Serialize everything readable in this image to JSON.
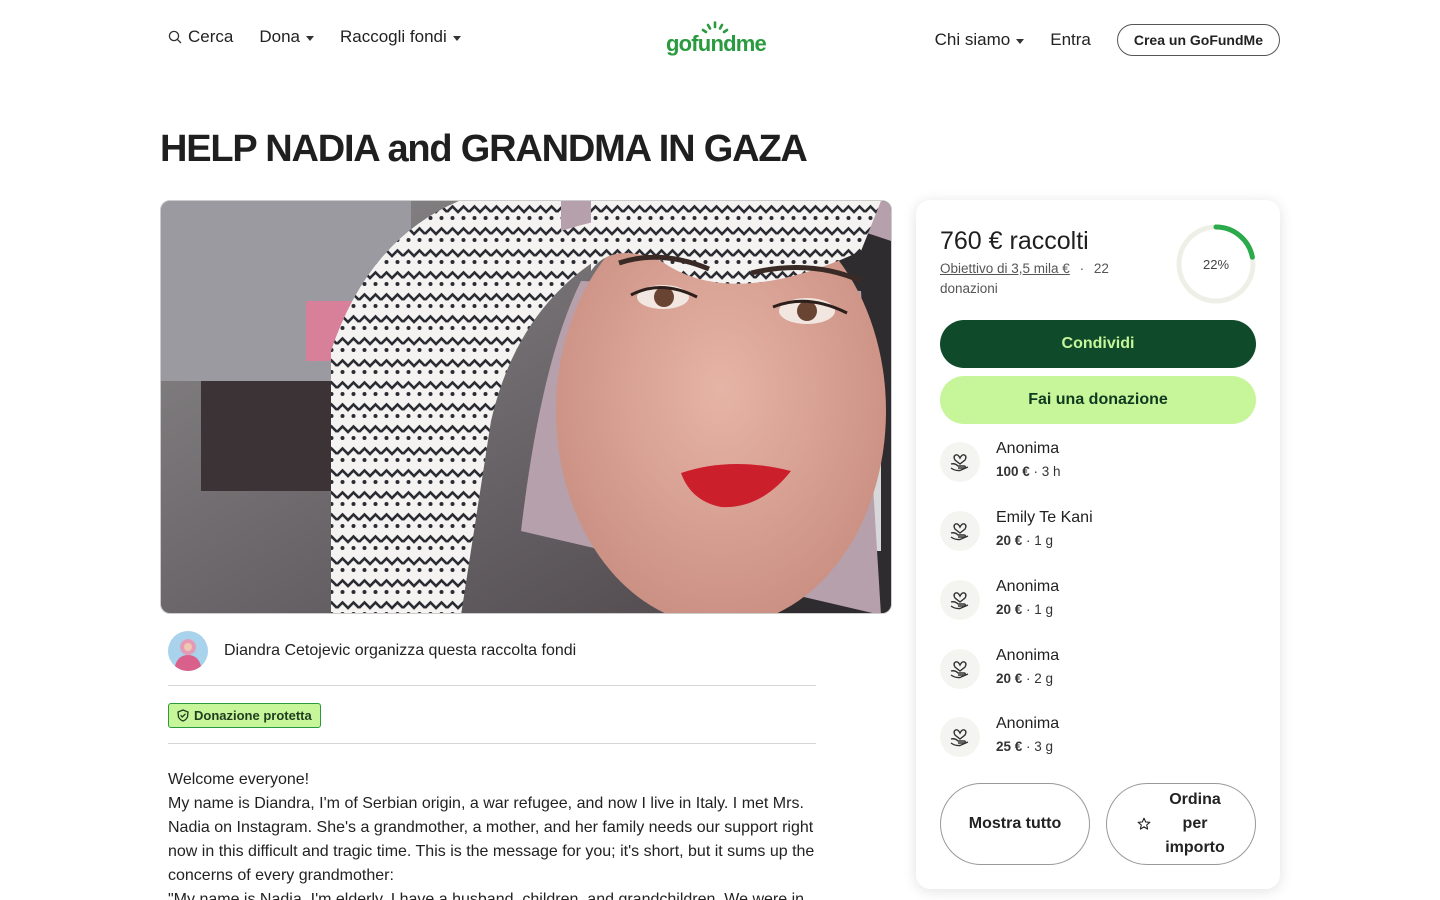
{
  "header": {
    "search_label": "Cerca",
    "donate_menu": "Dona",
    "raise_menu": "Raccogli fondi",
    "logo_text": "gofundme",
    "about_menu": "Chi siamo",
    "login_label": "Entra",
    "create_button": "Crea un GoFundMe"
  },
  "campaign": {
    "title": "HELP NADIA and GRANDMA IN GAZA",
    "organizer_text": "Diandra Cetojevic organizza questa raccolta fondi",
    "protected_badge": "Donazione protetta",
    "story": [
      "Welcome everyone!",
      "My name is Diandra, I'm of Serbian origin, a war refugee, and now I live in Italy. I met Mrs. Nadia on Instagram. She's a grandmother, a mother, and her family needs our support right now in this difficult and tragic time. This is the message for you; it's short, but it sums up the concerns of every grandmother:",
      "\"My name is Nadia, I'm elderly. I have a husband, children, and grandchildren. We were in"
    ]
  },
  "card": {
    "raised": "760 € raccolti",
    "goal": "Obiettivo di 3,5 mila €",
    "separator": "·",
    "donations": "22 donazioni",
    "progress_percent": 22,
    "progress_label": "22%",
    "share_button": "Condividi",
    "donate_button": "Fai una donazione",
    "donors": [
      {
        "name": "Anonima",
        "amount": "100 €",
        "time": "3 h"
      },
      {
        "name": "Emily Te Kani",
        "amount": "20 €",
        "time": "1 g"
      },
      {
        "name": "Anonima",
        "amount": "20 €",
        "time": "1 g"
      },
      {
        "name": "Anonima",
        "amount": "20 €",
        "time": "2 g"
      },
      {
        "name": "Anonima",
        "amount": "25 €",
        "time": "3 g"
      }
    ],
    "show_all_button": "Mostra tutto",
    "sort_button": "Ordina per importo"
  },
  "colors": {
    "brand_green": "#2a9a3f",
    "dark_green": "#0f4a2a",
    "lime": "#c7f59a"
  }
}
